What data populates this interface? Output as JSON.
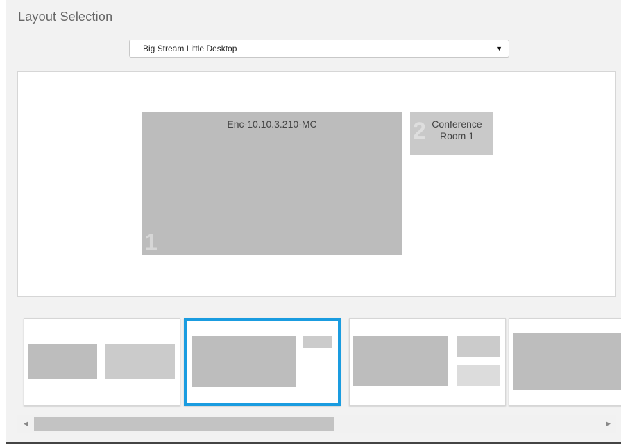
{
  "header": {
    "title": "Layout Selection"
  },
  "layout_select": {
    "value": "Big Stream Little Desktop",
    "arrow": "▼"
  },
  "preview": {
    "tiles": [
      {
        "label": "Enc-10.10.3.210-MC",
        "number": "1"
      },
      {
        "label": "Conference Room 1",
        "number": "2"
      }
    ]
  },
  "thumbnails": {
    "selected_index": 1,
    "count_visible": 4
  },
  "scrollbar": {
    "left_arrow": "◀",
    "right_arrow": "▶"
  },
  "colors": {
    "selection": "#1a9ce0",
    "tile": "#bcbcbc",
    "background": "#f2f2f2"
  }
}
